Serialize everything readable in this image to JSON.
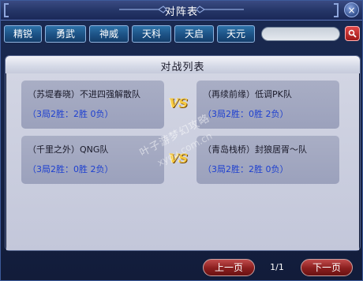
{
  "window": {
    "title": "对阵表",
    "close_label": "×"
  },
  "tabs": [
    {
      "label": "精锐"
    },
    {
      "label": "勇武"
    },
    {
      "label": "神威"
    },
    {
      "label": "天科"
    },
    {
      "label": "天启"
    },
    {
      "label": "天元"
    }
  ],
  "search": {
    "value": "",
    "button_icon": "search-icon"
  },
  "panel": {
    "title": "对战列表",
    "vs_label": "VS"
  },
  "matches": [
    {
      "left": {
        "name": "（苏堤春晓）不进四强解散队",
        "stats": "（3局2胜：2胜 0负）"
      },
      "right": {
        "name": "（再续前缘）低调PK队",
        "stats": "（3局2胜：0胜 2负）"
      }
    },
    {
      "left": {
        "name": "（千里之外）QNG队",
        "stats": "（3局2胜：0胜 2负）"
      },
      "right": {
        "name": "（青岛栈桥）封狼居胥～队",
        "stats": "（3局2胜：2胜 0负）"
      }
    }
  ],
  "watermark": {
    "line1": "叶子游梦幻攻略",
    "line2": "xyou.com.cn"
  },
  "pager": {
    "prev_label": "上一页",
    "page": "1/1",
    "next_label": "下一页"
  },
  "colors": {
    "accent_tab": "#1b4f82",
    "stats_text": "#1d3fd0",
    "vs": "#f5c840",
    "pager": "#8a1e1e"
  }
}
